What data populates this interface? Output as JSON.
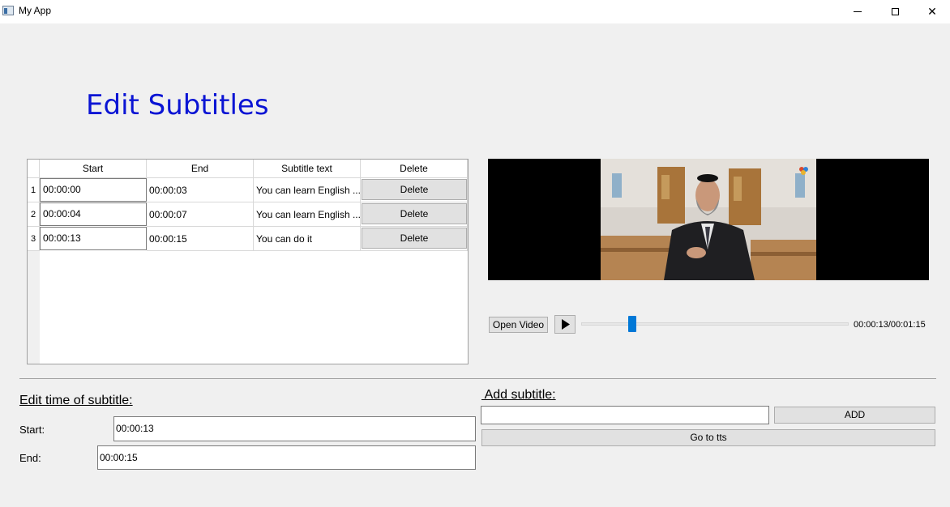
{
  "window": {
    "title": "My App"
  },
  "page_title": "Edit Subtitles",
  "table": {
    "headers": [
      "Start",
      "End",
      "Subtitle text",
      "Delete"
    ],
    "rows": [
      {
        "num": "1",
        "start": "00:00:00",
        "end": "00:00:03",
        "text": "You can learn English ...",
        "delete": "Delete"
      },
      {
        "num": "2",
        "start": "00:00:04",
        "end": "00:00:07",
        "text": "You can learn English ...",
        "delete": "Delete"
      },
      {
        "num": "3",
        "start": "00:00:13",
        "end": "00:00:15",
        "text": "You can do it",
        "delete": "Delete"
      }
    ]
  },
  "player": {
    "open_label": "Open Video",
    "play_icon": "play-icon",
    "position_fraction": 0.18,
    "time": "00:00:13/00:01:15"
  },
  "edit": {
    "heading": "Edit time of subtitle:",
    "start_label": "Start:",
    "start_value": "00:00:13",
    "end_label": "End:",
    "end_value": "00:00:15"
  },
  "add": {
    "heading": " Add subtitle:",
    "input_value": "",
    "add_label": "ADD",
    "tts_label": "Go to tts"
  },
  "colors": {
    "title": "#0a14d4",
    "accent": "#0078d7"
  }
}
